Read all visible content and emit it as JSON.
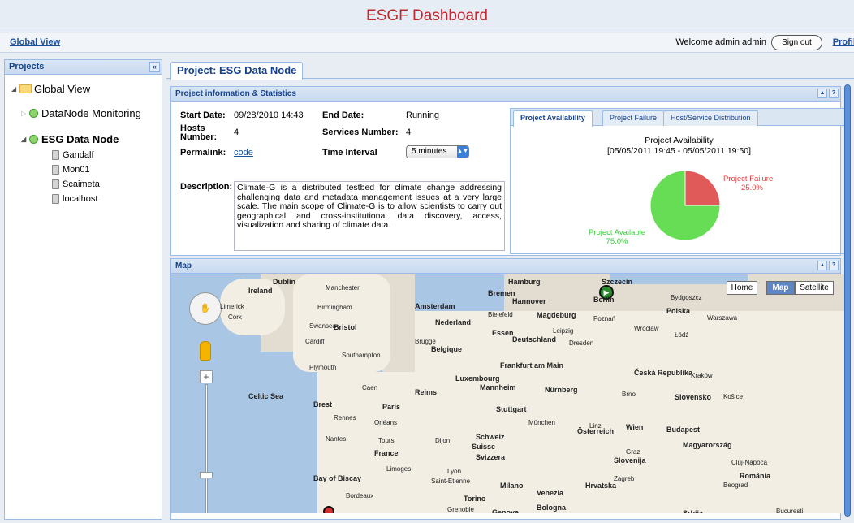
{
  "app": {
    "title": "ESGF Dashboard"
  },
  "nav": {
    "global_view": "Global View",
    "welcome": "Welcome  admin admin",
    "sign_out": "Sign out",
    "profile": "Profile"
  },
  "left_panel": {
    "title": "Projects",
    "collapse": "«",
    "tree": {
      "root": "Global View",
      "item1": "DataNode Monitoring",
      "item2": "ESG Data Node",
      "hosts": [
        "Gandalf",
        "Mon01",
        "Scaimeta",
        "localhost"
      ]
    }
  },
  "main": {
    "tab": "Project: ESG Data Node",
    "info_panel": {
      "title": "Project information & Statistics",
      "start_date_label": "Start Date:",
      "start_date": "09/28/2010 14:43",
      "end_date_label": "End Date:",
      "end_date": "Running",
      "hosts_label": "Hosts Number:",
      "hosts": "4",
      "services_label": "Services Number:",
      "services": "4",
      "permalink_label": "Permalink:",
      "permalink": "code",
      "interval_label": "Time Interval",
      "interval": "5 minutes",
      "description_label": "Description:",
      "description": "Climate-G is a distributed testbed for climate change addressing challenging data and metadata management issues at a very large scale. The main scope of Climate-G is to allow scientists to carry out geographical and cross-institutional data discovery, access, visualization and sharing of climate data."
    },
    "chart_tabs": [
      "Project Availability",
      "Project Failure",
      "Host/Service Distribution"
    ],
    "map_panel": {
      "title": "Map",
      "home": "Home",
      "map_btn": "Map",
      "satellite_btn": "Satellite"
    }
  },
  "chart_data": {
    "type": "pie",
    "title": "Project Availability",
    "subtitle": "[05/05/2011 19:45 - 05/05/2011 19:50]",
    "slices": [
      {
        "name": "Project Failure",
        "value": 25.0,
        "label": "25.0%",
        "color": "#e15a5a"
      },
      {
        "name": "Project Available",
        "value": 75.0,
        "label": "75.0%",
        "color": "#66dd55"
      }
    ]
  },
  "map_labels": {
    "cities": [
      "Dublin",
      "Ireland",
      "Limerick",
      "Cork",
      "Manchester",
      "Birmingham",
      "Swansea",
      "Bristol",
      "Cardiff",
      "Southampton",
      "Plymouth",
      "Celtic Sea",
      "Brest",
      "Rennes",
      "Nantes",
      "Bay of Biscay",
      "Bordeaux",
      "Caen",
      "Paris",
      "Amsterdam",
      "Nederland",
      "Brugge",
      "Belgique",
      "Reims",
      "Luxembourg",
      "Orléans",
      "Tours",
      "France",
      "Limoges",
      "Dijon",
      "Lyon",
      "Saint-Etienne",
      "Grenoble",
      "Hamburg",
      "Bremen",
      "Hannover",
      "Berlin",
      "Bielefeld",
      "Magdeburg",
      "Essen",
      "Deutschland",
      "Leipzig",
      "Dresden",
      "Frankfurt am Main",
      "Nürnberg",
      "Mannheim",
      "Stuttgart",
      "München",
      "Schweiz",
      "Suisse",
      "Svizzera",
      "Milano",
      "Torino",
      "Venezia",
      "Bologna",
      "Genova",
      "Österreich",
      "Wien",
      "Linz",
      "Graz",
      "Slovenija",
      "Zagreb",
      "Hrvatska",
      "Szczecin",
      "Poznań",
      "Polska",
      "Wrocław",
      "Łódź",
      "Warszawa",
      "Bydgoszcz",
      "Kraków",
      "Česká Republika",
      "Brno",
      "Slovensko",
      "Košice",
      "Budapest",
      "Magyarország",
      "România",
      "Beograd",
      "Srbija",
      "Cluj-Napoca",
      "Bucureşti"
    ]
  }
}
